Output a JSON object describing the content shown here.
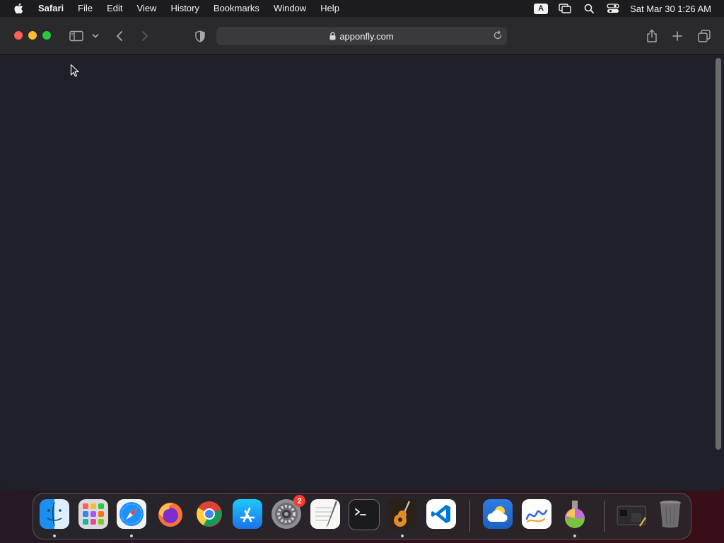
{
  "menubar": {
    "app_name": "Safari",
    "items": [
      "File",
      "Edit",
      "View",
      "History",
      "Bookmarks",
      "Window",
      "Help"
    ],
    "input_badge": "A",
    "clock": "Sat Mar 30  1:26 AM"
  },
  "browser": {
    "url": "apponfly.com"
  },
  "dock": {
    "apps": [
      {
        "name": "Finder",
        "running": true
      },
      {
        "name": "Launchpad",
        "running": false
      },
      {
        "name": "Safari",
        "running": true
      },
      {
        "name": "Firefox",
        "running": false
      },
      {
        "name": "Chrome",
        "running": false
      },
      {
        "name": "App Store",
        "running": false
      },
      {
        "name": "System Preferences",
        "running": false,
        "badge": "2"
      },
      {
        "name": "TextEdit",
        "running": false
      },
      {
        "name": "Terminal",
        "running": false
      },
      {
        "name": "GarageBand",
        "running": true
      },
      {
        "name": "Visual Studio Code",
        "running": false
      },
      {
        "name": "Weather",
        "running": false
      },
      {
        "name": "Freeform",
        "running": false
      },
      {
        "name": "Automator",
        "running": true
      },
      {
        "name": "Downloads",
        "running": false
      },
      {
        "name": "Trash",
        "running": false
      }
    ]
  },
  "colors": {
    "close": "#fe5f57",
    "minimize": "#febc2e",
    "maximize": "#28c840",
    "page_background": "#1f2029",
    "badge": "#ff3b30"
  }
}
